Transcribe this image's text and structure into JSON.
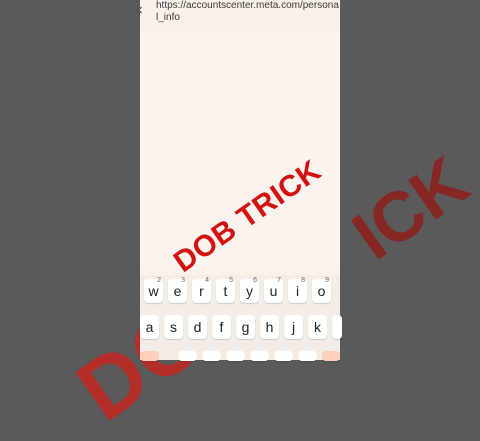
{
  "browser": {
    "url_text": "https://accountscenter.meta.com/personal_info",
    "url_icon": "✕"
  },
  "overlay": {
    "title": "DOB TRICK",
    "background_big": "DOB",
    "background_right": "ICK"
  },
  "keyboard": {
    "row1": [
      {
        "label": "w",
        "hint": "2"
      },
      {
        "label": "e",
        "hint": "3"
      },
      {
        "label": "r",
        "hint": "4"
      },
      {
        "label": "t",
        "hint": "5"
      },
      {
        "label": "y",
        "hint": "6"
      },
      {
        "label": "u",
        "hint": "7"
      },
      {
        "label": "i",
        "hint": "8"
      },
      {
        "label": "o",
        "hint": "9"
      }
    ],
    "row2": [
      {
        "label": "a"
      },
      {
        "label": "s"
      },
      {
        "label": "d"
      },
      {
        "label": "f"
      },
      {
        "label": "g"
      },
      {
        "label": "h"
      },
      {
        "label": "j"
      },
      {
        "label": "k"
      }
    ]
  }
}
